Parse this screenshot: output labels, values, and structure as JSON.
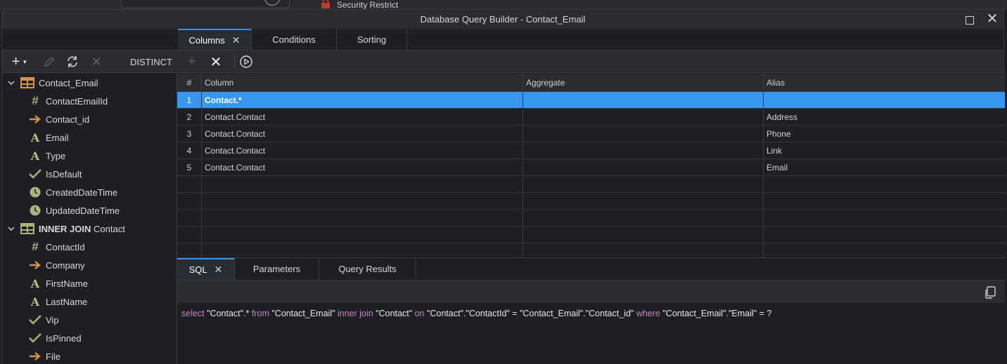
{
  "background": {
    "text": "Security Restrict"
  },
  "window": {
    "title": "Database Query Builder - Contact_Email"
  },
  "top_tabs": [
    {
      "label": "Columns",
      "active": true
    },
    {
      "label": "Conditions",
      "active": false
    },
    {
      "label": "Sorting",
      "active": false
    }
  ],
  "toolbar": {
    "distinct_label": "DISTINCT"
  },
  "tree": {
    "tables": [
      {
        "label": "Contact_Email",
        "fields": [
          {
            "name": "ContactEmailId",
            "icon": "hash-icon"
          },
          {
            "name": "Contact_id",
            "icon": "arrow-right-icon"
          },
          {
            "name": "Email",
            "icon": "text-type-icon"
          },
          {
            "name": "Type",
            "icon": "text-type-icon"
          },
          {
            "name": "IsDefault",
            "icon": "check-icon"
          },
          {
            "name": "CreatedDateTime",
            "icon": "clock-icon"
          },
          {
            "name": "UpdatedDateTime",
            "icon": "clock-icon"
          }
        ]
      },
      {
        "join_label": "INNER JOIN",
        "label": "Contact",
        "fields": [
          {
            "name": "ContactId",
            "icon": "hash-icon"
          },
          {
            "name": "Company",
            "icon": "arrow-right-icon"
          },
          {
            "name": "FirstName",
            "icon": "text-type-icon"
          },
          {
            "name": "LastName",
            "icon": "text-type-icon"
          },
          {
            "name": "Vip",
            "icon": "check-icon"
          },
          {
            "name": "IsPinned",
            "icon": "check-icon"
          },
          {
            "name": "File",
            "icon": "arrow-right-icon"
          }
        ]
      }
    ]
  },
  "grid": {
    "headers": {
      "num": "#",
      "column": "Column",
      "aggregate": "Aggregate",
      "alias": "Alias"
    },
    "rows": [
      {
        "num": "1",
        "column": "Contact.*",
        "aggregate": "",
        "alias": ""
      },
      {
        "num": "2",
        "column": "Contact.Contact",
        "aggregate": "",
        "alias": "Address"
      },
      {
        "num": "3",
        "column": "Contact.Contact",
        "aggregate": "",
        "alias": "Phone"
      },
      {
        "num": "4",
        "column": "Contact.Contact",
        "aggregate": "",
        "alias": "Link"
      },
      {
        "num": "5",
        "column": "Contact.Contact",
        "aggregate": "",
        "alias": "Email"
      }
    ],
    "selected_row": 1,
    "empty_rows": 5
  },
  "bottom_tabs": [
    {
      "label": "SQL",
      "active": true
    },
    {
      "label": "Parameters",
      "active": false
    },
    {
      "label": "Query Results",
      "active": false
    }
  ],
  "sql": {
    "tokens": [
      {
        "text": "select",
        "kw": true
      },
      {
        "text": " \"Contact\".* ",
        "kw": false
      },
      {
        "text": "from",
        "kw": true
      },
      {
        "text": " \"Contact_Email\" ",
        "kw": false
      },
      {
        "text": "inner join",
        "kw": true
      },
      {
        "text": " \"Contact\" ",
        "kw": false
      },
      {
        "text": "on",
        "kw": true
      },
      {
        "text": " \"Contact\".\"ContactId\" = \"Contact_Email\".\"Contact_id\" ",
        "kw": false
      },
      {
        "text": "where",
        "kw": true
      },
      {
        "text": " \"Contact_Email\".\"Email\" = ?",
        "kw": false
      }
    ]
  },
  "colors": {
    "accent": "#3b8fe0",
    "selection": "#3797ee",
    "table_icon": "#d8914a",
    "join_table_icon": "#a9b37d",
    "field_icon": "#a9b37d",
    "fk_arrow": "#d8914a",
    "keyword": "#c586c0"
  }
}
